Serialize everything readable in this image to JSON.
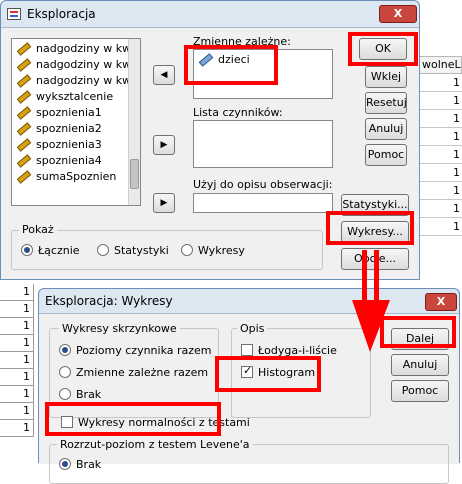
{
  "spreadsheet": {
    "column_header": "wolneL",
    "right_cells": [
      "1",
      "1",
      "1",
      "1",
      "1",
      "1",
      "1",
      "1",
      "1"
    ],
    "left_cells": [
      "1",
      "1",
      "1",
      "1",
      "1",
      "1",
      "1",
      "1",
      "1"
    ]
  },
  "explore": {
    "title": "Eksploracja",
    "close_symbol": "X",
    "variables": [
      "nadgodziny w kwa",
      "nadgodziny w kwa",
      "nadgodziny w kwa",
      "wyksztalcenie",
      "spoznienia1",
      "spoznienia2",
      "spoznienia3",
      "spoznienia4",
      "sumaSpoznien"
    ],
    "dependent_label": "Zmienne zależne:",
    "dependent_item": "dzieci",
    "factor_label": "Lista czynników:",
    "case_label": "Użyj do opisu obserwacji:",
    "buttons": {
      "ok": "OK",
      "paste": "Wklej",
      "reset": "Resetuj",
      "cancel": "Anuluj",
      "help": "Pomoc",
      "statistics": "Statystyki...",
      "plots": "Wykresy...",
      "options": "Opcje..."
    },
    "display_label": "Pokaż",
    "display_options": [
      "Łącznie",
      "Statystyki",
      "Wykresy"
    ]
  },
  "plots": {
    "title": "Eksploracja: Wykresy",
    "close_symbol": "X",
    "boxplots_label": "Wykresy skrzynkowe",
    "boxplot_options": [
      "Poziomy czynnika razem",
      "Zmienne zależne razem",
      "Brak"
    ],
    "descriptive_label": "Opis",
    "stem_leaf": "Łodyga-i-liście",
    "histogram": "Histogram",
    "normality": "Wykresy normalności z testami",
    "levene_label": "Rozrzut-poziom z testem Levene'a",
    "levene_first": "Brak",
    "buttons": {
      "continue": "Dalej",
      "cancel": "Anuluj",
      "help": "Pomoc"
    }
  },
  "annotations": {
    "color": "#ff0000"
  }
}
